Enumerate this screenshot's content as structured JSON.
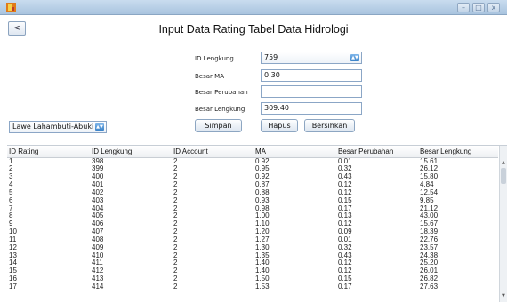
{
  "window": {
    "minimize": "–",
    "maximize": "□",
    "close": "x"
  },
  "back_label": "<",
  "title": "Input Data Rating Tabel Data Hidrologi",
  "form": {
    "id_lengkung_label": "ID Lengkung",
    "id_lengkung_value": "759",
    "besar_ma_label": "Besar MA",
    "besar_ma_value": "0.30",
    "besar_perubahan_label": "Besar Perubahan",
    "besar_perubahan_value": "",
    "besar_lengkung_label": "Besar Lengkung",
    "besar_lengkung_value": "309.40"
  },
  "location_select": "Lawe Lahambuti-Abuki",
  "buttons": {
    "simpan": "Simpan",
    "hapus": "Hapus",
    "bersihkan": "Bersihkan"
  },
  "table": {
    "headers": [
      "ID Rating",
      "ID Lengkung",
      "ID Account",
      "MA",
      "Besar Perubahan",
      "Besar Lengkung"
    ],
    "rows": [
      [
        "1",
        "398",
        "2",
        "0.92",
        "0.01",
        "15.61"
      ],
      [
        "2",
        "399",
        "2",
        "0.95",
        "0.32",
        "26.12"
      ],
      [
        "3",
        "400",
        "2",
        "0.92",
        "0.43",
        "15.80"
      ],
      [
        "4",
        "401",
        "2",
        "0.87",
        "0.12",
        "4.84"
      ],
      [
        "5",
        "402",
        "2",
        "0.88",
        "0.12",
        "12.54"
      ],
      [
        "6",
        "403",
        "2",
        "0.93",
        "0.15",
        "9.85"
      ],
      [
        "7",
        "404",
        "2",
        "0.98",
        "0.17",
        "21.12"
      ],
      [
        "8",
        "405",
        "2",
        "1.00",
        "0.13",
        "43.00"
      ],
      [
        "9",
        "406",
        "2",
        "1.10",
        "0.12",
        "15.67"
      ],
      [
        "10",
        "407",
        "2",
        "1.20",
        "0.09",
        "18.39"
      ],
      [
        "11",
        "408",
        "2",
        "1.27",
        "0.01",
        "22.76"
      ],
      [
        "12",
        "409",
        "2",
        "1.30",
        "0.32",
        "23.57"
      ],
      [
        "13",
        "410",
        "2",
        "1.35",
        "0.43",
        "24.38"
      ],
      [
        "14",
        "411",
        "2",
        "1.40",
        "0.12",
        "25.20"
      ],
      [
        "15",
        "412",
        "2",
        "1.40",
        "0.12",
        "26.01"
      ],
      [
        "16",
        "413",
        "2",
        "1.50",
        "0.15",
        "26.82"
      ],
      [
        "17",
        "414",
        "2",
        "1.53",
        "0.17",
        "27.63"
      ]
    ]
  },
  "colors": {
    "titlebar": "#b4cbe3",
    "accent": "#3b82c8",
    "field_border": "#8ba6c6"
  }
}
